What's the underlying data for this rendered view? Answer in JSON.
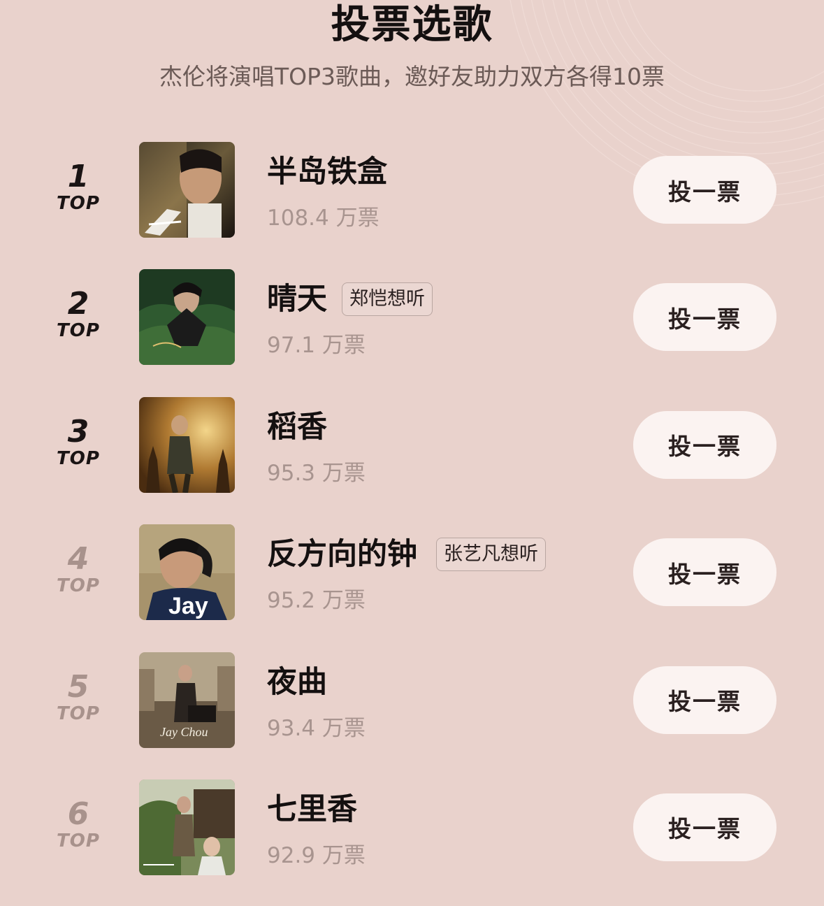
{
  "header": {
    "title": "投票选歌",
    "subtitle": "杰伦将演唱TOP3歌曲，邀好友助力双方各得10票"
  },
  "colors": {
    "background": "#e9d2cc",
    "button_bg": "#fbf3f1",
    "rank_active": "#1a1414",
    "rank_muted": "#a8928c",
    "votes_text": "#a8948f"
  },
  "songs": [
    {
      "rank": "1",
      "rank_label": "TOP",
      "name": "半岛铁盒",
      "votes": "108.4 万票",
      "tag": "",
      "vote_label": "投一票",
      "cover": "album-cover-eight-dimensions"
    },
    {
      "rank": "2",
      "rank_label": "TOP",
      "name": "晴天",
      "votes": "97.1 万票",
      "tag": "郑恺想听",
      "vote_label": "投一票",
      "cover": "album-cover-ye-hui-mei"
    },
    {
      "rank": "3",
      "rank_label": "TOP",
      "name": "稻香",
      "votes": "95.3 万票",
      "tag": "",
      "vote_label": "投一票",
      "cover": "album-cover-capricorn"
    },
    {
      "rank": "4",
      "rank_label": "TOP",
      "name": "反方向的钟",
      "votes": "95.2 万票",
      "tag": "张艺凡想听",
      "vote_label": "投一票",
      "cover": "album-cover-jay"
    },
    {
      "rank": "5",
      "rank_label": "TOP",
      "name": "夜曲",
      "votes": "93.4 万票",
      "tag": "",
      "vote_label": "投一票",
      "cover": "album-cover-november-chopin"
    },
    {
      "rank": "6",
      "rank_label": "TOP",
      "name": "七里香",
      "votes": "92.9 万票",
      "tag": "",
      "vote_label": "投一票",
      "cover": "album-cover-common-jasmine"
    }
  ]
}
